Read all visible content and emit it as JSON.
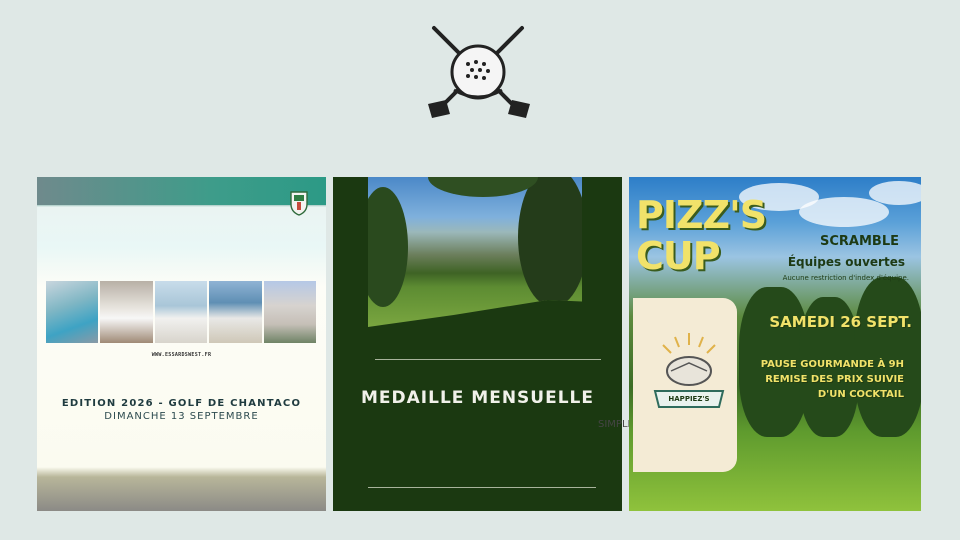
{
  "logo": {
    "icon": "golf-crossed-clubs-icon"
  },
  "cards": [
    {
      "photos_label": "hotel-photos",
      "url": "WWW.ESSARDSWEST.FR",
      "edition": "EDITION 2026 - GOLF DE CHANTACO",
      "date": "DIMANCHE 13 SEPTEMBRE"
    },
    {
      "title": "MEDAILLE MENSUELLE",
      "subtitle": "SIMPLE PAR SERIES"
    },
    {
      "title_line1": "PIZZ'S",
      "title_line2": "CUP",
      "format": "SCRAMBLE",
      "teams": "Équipes ouvertes",
      "restriction": "Aucune restriction d'index d'équipe.",
      "date": "SAMEDI 26 SEPT.",
      "info_line1": "PAUSE GOURMANDE À 9H",
      "info_line2": "REMISE DES PRIX SUIVIE",
      "info_line3": "D'UN COCKTAIL",
      "badge": "HAPPIEZ'S"
    }
  ]
}
